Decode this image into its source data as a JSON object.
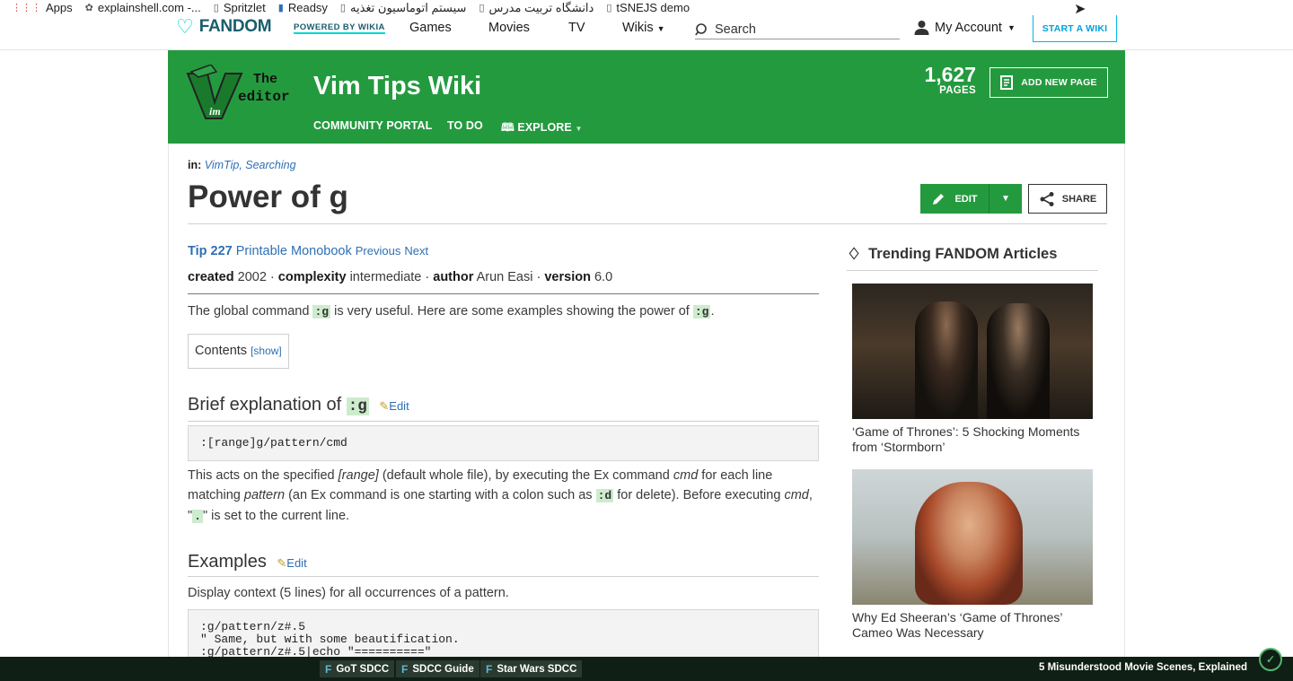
{
  "bookmarks": [
    {
      "label": "Apps",
      "icon": "apps-grid-icon"
    },
    {
      "label": "explainshell.com -...",
      "icon": "shell-icon"
    },
    {
      "label": "Spritzlet",
      "icon": "page-icon"
    },
    {
      "label": "Readsy",
      "icon": "bookmark-icon"
    },
    {
      "label": "سیستم اتوماسیون تغذیه",
      "icon": "page-icon"
    },
    {
      "label": "دانشگاه تربیت مدرس",
      "icon": "page-icon"
    },
    {
      "label": "tSNEJS demo",
      "icon": "page-icon"
    }
  ],
  "topnav": {
    "logo": "FANDOM",
    "powered": "POWERED BY WIKIA",
    "links": [
      "Games",
      "Movies",
      "TV",
      "Wikis"
    ],
    "search_placeholder": "Search",
    "account": "My Account",
    "start_wiki": "START A WIKI"
  },
  "wiki": {
    "logo_text_1": "The",
    "logo_text_2": "editor",
    "title": "Vim Tips Wiki",
    "nav": [
      "COMMUNITY PORTAL",
      "TO DO",
      "EXPLORE"
    ],
    "page_count": "1,627",
    "page_label": "PAGES",
    "add_page": "ADD NEW PAGE"
  },
  "article": {
    "categories_label": "in:",
    "categories": "VimTip, Searching",
    "title": "Power of g",
    "edit": "EDIT",
    "share": "SHARE",
    "tip_label": "Tip 227",
    "printable": "Printable Monobook",
    "previous": "Previous",
    "next": "Next",
    "meta": {
      "created_label": "created",
      "created": "2002",
      "complexity_label": "complexity",
      "complexity": "intermediate",
      "author_label": "author",
      "author": "Arun Easi",
      "version_label": "version",
      "version": "6.0"
    },
    "intro_1": "The global command",
    "intro_code": ":g",
    "intro_2": "is very useful. Here are some examples showing the power of",
    "intro_code2": ":g",
    "intro_3": ".",
    "toc_label": "Contents",
    "toc_toggle": "[show]",
    "section1_title": "Brief explanation of",
    "section1_code": ":g",
    "edit_link": "Edit",
    "section1_codeblock": ":[range]g/pattern/cmd",
    "section1_p_1": "This acts on the specified",
    "section1_p_range": "[range]",
    "section1_p_2": "(default whole file), by executing the Ex command",
    "section1_p_cmd": "cmd",
    "section1_p_3": "for each line matching",
    "section1_p_pattern": "pattern",
    "section1_p_4": "(an Ex command is one starting with a colon such as",
    "section1_p_code": ":d",
    "section1_p_5": "for delete). Before executing",
    "section1_p_cmd2": "cmd",
    "section1_p_6": ", \"",
    "section1_p_dot": ".",
    "section1_p_7": "\" is set to the current line.",
    "section2_title": "Examples",
    "section2_p": "Display context (5 lines) for all occurrences of a pattern.",
    "section2_codeblock": ":g/pattern/z#.5\n\" Same, but with some beautification.\n:g/pattern/z#.5|echo \"==========\""
  },
  "rail": {
    "title": "Trending FANDOM Articles",
    "cards": [
      {
        "caption": "‘Game of Thrones’: 5 Shocking Moments from ‘Stormborn’"
      },
      {
        "caption": "Why Ed Sheeran’s ‘Game of Thrones’ Cameo Was Necessary"
      }
    ]
  },
  "bottombar": {
    "items": [
      "GoT SDCC",
      "SDCC Guide",
      "Star Wars SDCC"
    ],
    "promo": "5 Misunderstood Movie Scenes, Explained"
  },
  "colors": {
    "wiki_green": "#249a3f",
    "fandom_teal": "#00d6d6",
    "link_blue": "#2e6fb4",
    "bottom_bar": "#0f1f15"
  }
}
